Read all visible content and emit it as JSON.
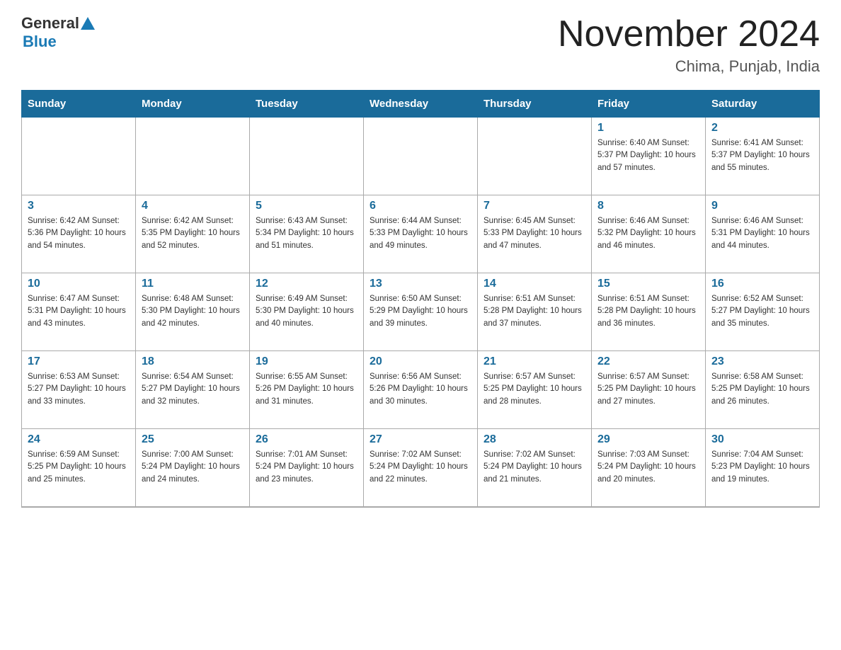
{
  "header": {
    "logo_general": "General",
    "logo_blue": "Blue",
    "title": "November 2024",
    "subtitle": "Chima, Punjab, India"
  },
  "weekdays": [
    "Sunday",
    "Monday",
    "Tuesday",
    "Wednesday",
    "Thursday",
    "Friday",
    "Saturday"
  ],
  "rows": [
    [
      {
        "day": "",
        "info": ""
      },
      {
        "day": "",
        "info": ""
      },
      {
        "day": "",
        "info": ""
      },
      {
        "day": "",
        "info": ""
      },
      {
        "day": "",
        "info": ""
      },
      {
        "day": "1",
        "info": "Sunrise: 6:40 AM\nSunset: 5:37 PM\nDaylight: 10 hours and 57 minutes."
      },
      {
        "day": "2",
        "info": "Sunrise: 6:41 AM\nSunset: 5:37 PM\nDaylight: 10 hours and 55 minutes."
      }
    ],
    [
      {
        "day": "3",
        "info": "Sunrise: 6:42 AM\nSunset: 5:36 PM\nDaylight: 10 hours and 54 minutes."
      },
      {
        "day": "4",
        "info": "Sunrise: 6:42 AM\nSunset: 5:35 PM\nDaylight: 10 hours and 52 minutes."
      },
      {
        "day": "5",
        "info": "Sunrise: 6:43 AM\nSunset: 5:34 PM\nDaylight: 10 hours and 51 minutes."
      },
      {
        "day": "6",
        "info": "Sunrise: 6:44 AM\nSunset: 5:33 PM\nDaylight: 10 hours and 49 minutes."
      },
      {
        "day": "7",
        "info": "Sunrise: 6:45 AM\nSunset: 5:33 PM\nDaylight: 10 hours and 47 minutes."
      },
      {
        "day": "8",
        "info": "Sunrise: 6:46 AM\nSunset: 5:32 PM\nDaylight: 10 hours and 46 minutes."
      },
      {
        "day": "9",
        "info": "Sunrise: 6:46 AM\nSunset: 5:31 PM\nDaylight: 10 hours and 44 minutes."
      }
    ],
    [
      {
        "day": "10",
        "info": "Sunrise: 6:47 AM\nSunset: 5:31 PM\nDaylight: 10 hours and 43 minutes."
      },
      {
        "day": "11",
        "info": "Sunrise: 6:48 AM\nSunset: 5:30 PM\nDaylight: 10 hours and 42 minutes."
      },
      {
        "day": "12",
        "info": "Sunrise: 6:49 AM\nSunset: 5:30 PM\nDaylight: 10 hours and 40 minutes."
      },
      {
        "day": "13",
        "info": "Sunrise: 6:50 AM\nSunset: 5:29 PM\nDaylight: 10 hours and 39 minutes."
      },
      {
        "day": "14",
        "info": "Sunrise: 6:51 AM\nSunset: 5:28 PM\nDaylight: 10 hours and 37 minutes."
      },
      {
        "day": "15",
        "info": "Sunrise: 6:51 AM\nSunset: 5:28 PM\nDaylight: 10 hours and 36 minutes."
      },
      {
        "day": "16",
        "info": "Sunrise: 6:52 AM\nSunset: 5:27 PM\nDaylight: 10 hours and 35 minutes."
      }
    ],
    [
      {
        "day": "17",
        "info": "Sunrise: 6:53 AM\nSunset: 5:27 PM\nDaylight: 10 hours and 33 minutes."
      },
      {
        "day": "18",
        "info": "Sunrise: 6:54 AM\nSunset: 5:27 PM\nDaylight: 10 hours and 32 minutes."
      },
      {
        "day": "19",
        "info": "Sunrise: 6:55 AM\nSunset: 5:26 PM\nDaylight: 10 hours and 31 minutes."
      },
      {
        "day": "20",
        "info": "Sunrise: 6:56 AM\nSunset: 5:26 PM\nDaylight: 10 hours and 30 minutes."
      },
      {
        "day": "21",
        "info": "Sunrise: 6:57 AM\nSunset: 5:25 PM\nDaylight: 10 hours and 28 minutes."
      },
      {
        "day": "22",
        "info": "Sunrise: 6:57 AM\nSunset: 5:25 PM\nDaylight: 10 hours and 27 minutes."
      },
      {
        "day": "23",
        "info": "Sunrise: 6:58 AM\nSunset: 5:25 PM\nDaylight: 10 hours and 26 minutes."
      }
    ],
    [
      {
        "day": "24",
        "info": "Sunrise: 6:59 AM\nSunset: 5:25 PM\nDaylight: 10 hours and 25 minutes."
      },
      {
        "day": "25",
        "info": "Sunrise: 7:00 AM\nSunset: 5:24 PM\nDaylight: 10 hours and 24 minutes."
      },
      {
        "day": "26",
        "info": "Sunrise: 7:01 AM\nSunset: 5:24 PM\nDaylight: 10 hours and 23 minutes."
      },
      {
        "day": "27",
        "info": "Sunrise: 7:02 AM\nSunset: 5:24 PM\nDaylight: 10 hours and 22 minutes."
      },
      {
        "day": "28",
        "info": "Sunrise: 7:02 AM\nSunset: 5:24 PM\nDaylight: 10 hours and 21 minutes."
      },
      {
        "day": "29",
        "info": "Sunrise: 7:03 AM\nSunset: 5:24 PM\nDaylight: 10 hours and 20 minutes."
      },
      {
        "day": "30",
        "info": "Sunrise: 7:04 AM\nSunset: 5:23 PM\nDaylight: 10 hours and 19 minutes."
      }
    ]
  ]
}
